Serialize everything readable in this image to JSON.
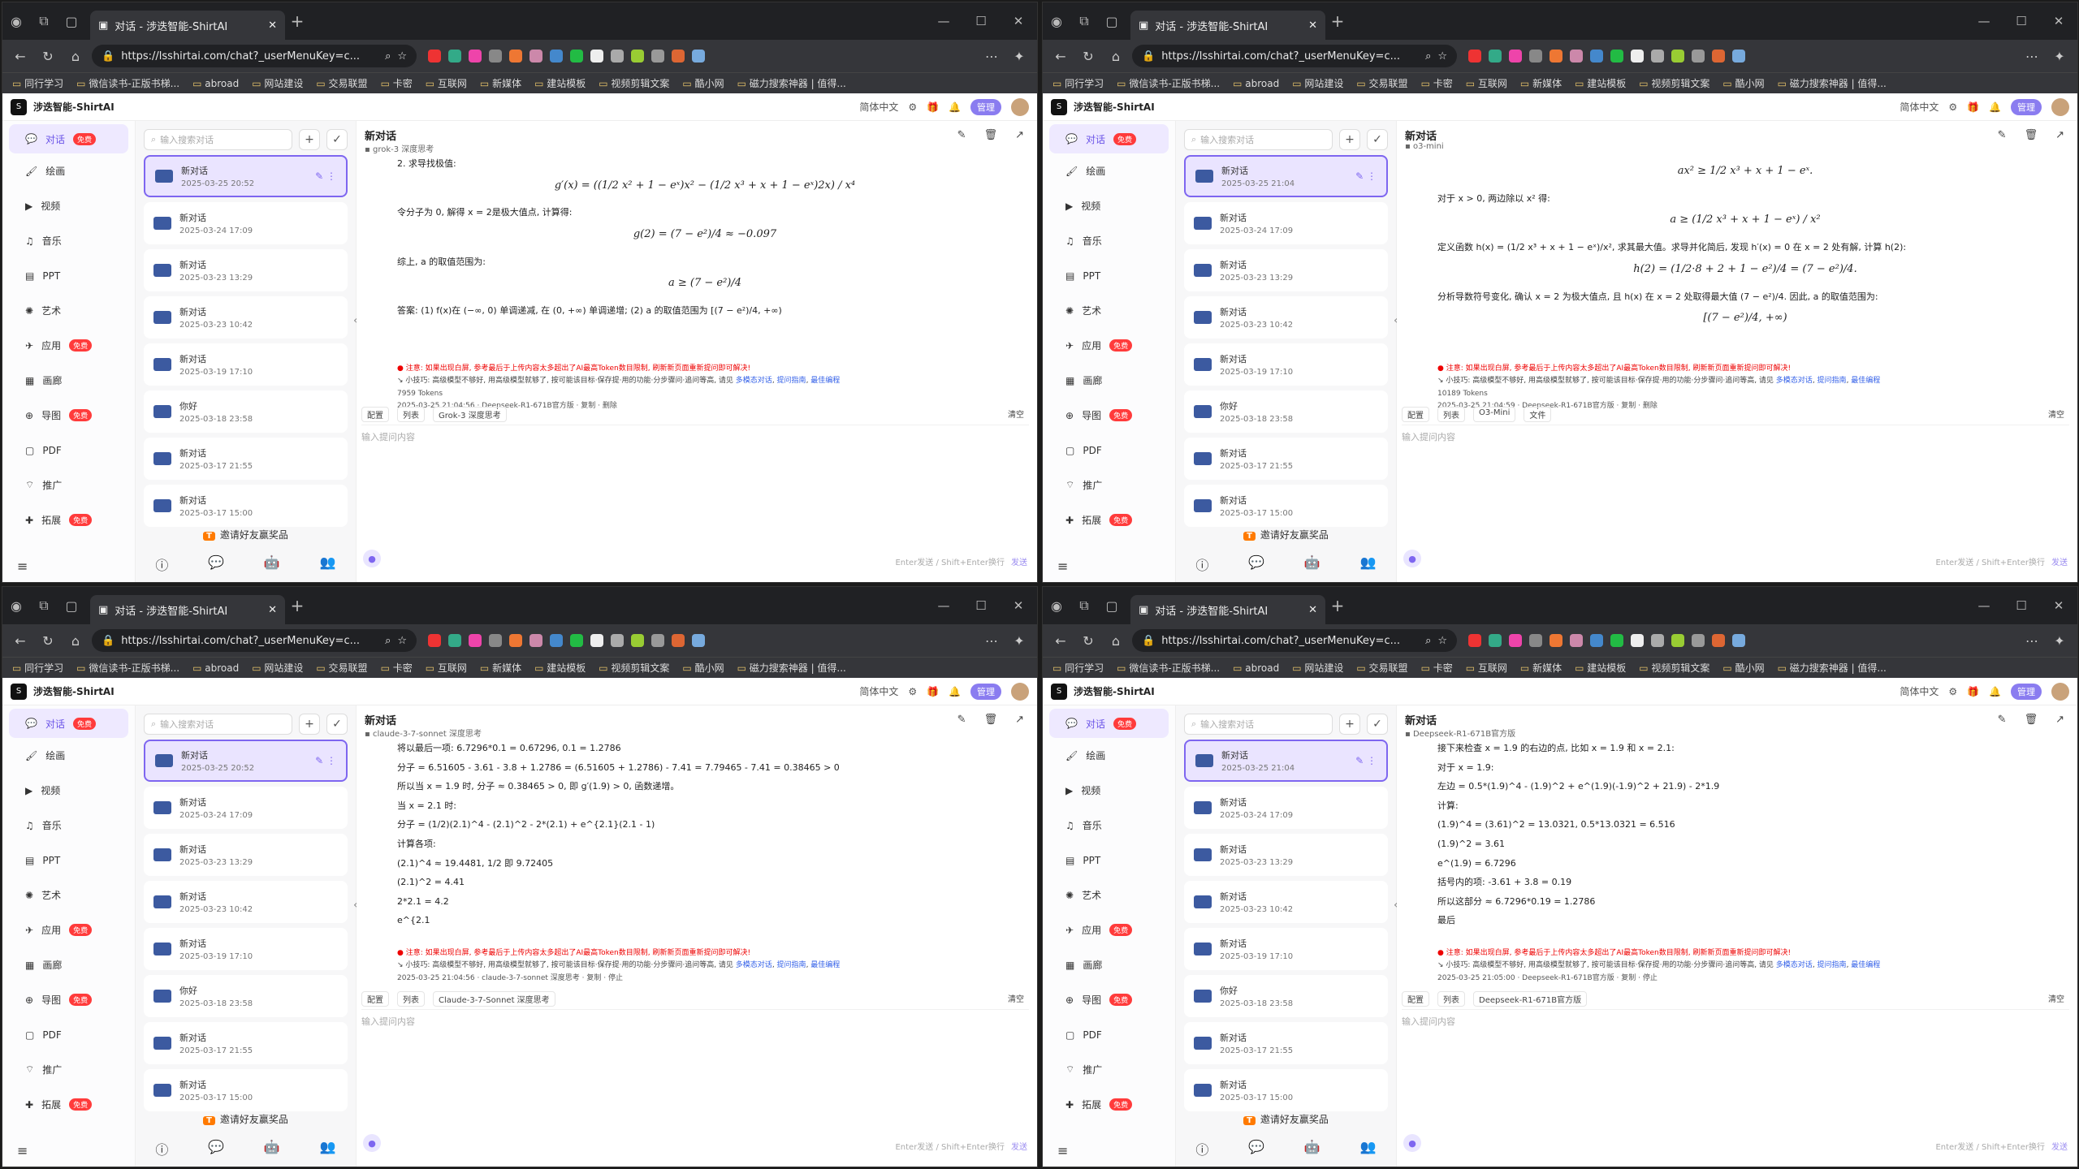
{
  "browser": {
    "tab_title": "对话 - 涉迭智能-ShirtAI",
    "url": "https://lsshirtai.com/chat?_userMenuKey=c...",
    "bookmarks": [
      "同行学习",
      "微信读书-正版书梯...",
      "abroad",
      "网站建设",
      "交易联盟",
      "卡密",
      "互联网",
      "新媒体",
      "建站模板",
      "视频剪辑文案",
      "酷小网",
      "磁力搜索神器 | 值得..."
    ]
  },
  "app": {
    "title": "涉迭智能-ShirtAI",
    "lang": "简体中文",
    "admin": "管理",
    "nav": [
      {
        "label": "对话",
        "badge": "免费"
      },
      {
        "label": "绘画",
        "badge": ""
      },
      {
        "label": "视频",
        "badge": ""
      },
      {
        "label": "音乐",
        "badge": ""
      },
      {
        "label": "PPT",
        "badge": ""
      },
      {
        "label": "艺术",
        "badge": ""
      },
      {
        "label": "应用",
        "badge": "免费"
      },
      {
        "label": "画廊",
        "badge": ""
      },
      {
        "label": "导图",
        "badge": "免费"
      },
      {
        "label": "PDF",
        "badge": ""
      },
      {
        "label": "推广",
        "badge": ""
      },
      {
        "label": "拓展",
        "badge": "免费"
      }
    ],
    "search_placeholder": "输入搜索对话",
    "invite": "邀请好友赢奖品",
    "input_placeholder": "输入提问内容",
    "send_hint": "Enter发送 / Shift+Enter换行",
    "send": "发送",
    "clear": "清空",
    "toolbar_config": "配置",
    "toolbar_list": "列表",
    "warn": "注意: 如果出现白屏, 参考最后于上传内容太多超出了AI最高Token数目限制, 刷新新页面重新提问即可解决!",
    "tip_pre": "小技巧: 高级模型不够好, 用高级模型就够了, 按可能该目标·保存提·用的功能·分步骤问·追问等高, 请见",
    "tip_links": [
      "多模态对话",
      "提问指南",
      "最佳编程"
    ]
  },
  "windows": [
    {
      "selected_date": "2025-03-25 20:52",
      "conv_list": [
        {
          "title": "新对话",
          "date": "2025-03-25 20:52"
        },
        {
          "title": "新对话",
          "date": "2025-03-24 17:09"
        },
        {
          "title": "新对话",
          "date": "2025-03-23 13:29"
        },
        {
          "title": "新对话",
          "date": "2025-03-23 10:42"
        },
        {
          "title": "新对话",
          "date": "2025-03-19 17:10"
        },
        {
          "title": "你好",
          "date": "2025-03-18 23:58"
        },
        {
          "title": "新对话",
          "date": "2025-03-17 21:55"
        },
        {
          "title": "新对话",
          "date": "2025-03-17 15:00"
        }
      ],
      "main_title": "新对话",
      "model": "grok-3 深度思考",
      "content": [
        {
          "t": "line",
          "v": "2. 求导找极值:"
        },
        {
          "t": "eq",
          "v": "g′(x) = ((1/2 x² + 1 − eˣ)x² − (1/2 x³ + x + 1 − eˣ)2x) / x⁴"
        },
        {
          "t": "line",
          "v": "令分子为 0, 解得 x = 2是极大值点, 计算得:"
        },
        {
          "t": "eq",
          "v": "g(2) = (7 − e²)/4 ≈ −0.097"
        },
        {
          "t": "line",
          "v": "综上, a 的取值范围为:"
        },
        {
          "t": "eq",
          "v": "a ≥ (7 − e²)/4"
        },
        {
          "t": "line",
          "v": "答案: (1) f(x)在 (−∞, 0) 单调递减, 在 (0, +∞) 单调递增; (2) a 的取值范围为 [(7 − e²)/4, +∞)"
        }
      ],
      "tokens": "7959 Tokens",
      "stamp": "2025-03-25 21:04:56 · Deepseek-R1-671B官方版 · 复制 · 删除",
      "model_chip": "Grok-3 深度思考",
      "extra_chip": ""
    },
    {
      "selected_date": "2025-03-25 21:04",
      "conv_list": [
        {
          "title": "新对话",
          "date": "2025-03-25 21:04"
        },
        {
          "title": "新对话",
          "date": "2025-03-24 17:09"
        },
        {
          "title": "新对话",
          "date": "2025-03-23 13:29"
        },
        {
          "title": "新对话",
          "date": "2025-03-23 10:42"
        },
        {
          "title": "新对话",
          "date": "2025-03-19 17:10"
        },
        {
          "title": "你好",
          "date": "2025-03-18 23:58"
        },
        {
          "title": "新对话",
          "date": "2025-03-17 21:55"
        },
        {
          "title": "新对话",
          "date": "2025-03-17 15:00"
        }
      ],
      "main_title": "新对话",
      "model": "o3-mini",
      "content": [
        {
          "t": "eq",
          "v": "ax² ≥ 1/2 x³ + x + 1 − eˣ."
        },
        {
          "t": "line",
          "v": "对于 x > 0, 两边除以 x² 得:"
        },
        {
          "t": "eq",
          "v": "a ≥ (1/2 x³ + x + 1 − eˣ) / x²"
        },
        {
          "t": "line",
          "v": "定义函数 h(x) = (1/2 x³ + x + 1 − eˣ)/x², 求其最大值。求导并化简后, 发现 h′(x) = 0 在 x = 2 处有解, 计算 h(2):"
        },
        {
          "t": "eq",
          "v": "h(2) = (1/2·8 + 2 + 1 − e²)/4 = (7 − e²)/4."
        },
        {
          "t": "line",
          "v": "分析导数符号变化, 确认 x = 2 为极大值点, 且 h(x) 在 x = 2 处取得最大值 (7 − e²)/4. 因此, a 的取值范围为:"
        },
        {
          "t": "eq",
          "v": "[(7 − e²)/4, +∞)"
        }
      ],
      "tokens": "10189 Tokens",
      "stamp": "2025-03-25 21:04:59 · Deepseek-R1-671B官方版 · 复制 · 删除",
      "model_chip": "O3-Mini",
      "extra_chip": "文件"
    },
    {
      "selected_date": "2025-03-25 20:52",
      "conv_list": [
        {
          "title": "新对话",
          "date": "2025-03-25 20:52"
        },
        {
          "title": "新对话",
          "date": "2025-03-24 17:09"
        },
        {
          "title": "新对话",
          "date": "2025-03-23 13:29"
        },
        {
          "title": "新对话",
          "date": "2025-03-23 10:42"
        },
        {
          "title": "新对话",
          "date": "2025-03-19 17:10"
        },
        {
          "title": "你好",
          "date": "2025-03-18 23:58"
        },
        {
          "title": "新对话",
          "date": "2025-03-17 21:55"
        },
        {
          "title": "新对话",
          "date": "2025-03-17 15:00"
        }
      ],
      "main_title": "新对话",
      "model": "claude-3-7-sonnet 深度思考",
      "content": [
        {
          "t": "line",
          "v": "将以最后一项: 6.7296*0.1 = 0.67296, 0.1 = 1.2786"
        },
        {
          "t": "line",
          "v": "分子 = 6.51605 - 3.61 - 3.8 + 1.2786 = (6.51605 + 1.2786) - 7.41 = 7.79465 - 7.41 = 0.38465 > 0"
        },
        {
          "t": "line",
          "v": "所以当 x = 1.9 时, 分子 ≈ 0.38465 > 0, 即 g′(1.9) > 0, 函数递增。"
        },
        {
          "t": "line",
          "v": "当 x = 2.1 时:"
        },
        {
          "t": "line",
          "v": "分子 = (1/2)(2.1)^4 - (2.1)^2 - 2*(2.1) + e^{2.1}(2.1 - 1)"
        },
        {
          "t": "line",
          "v": "计算各项:"
        },
        {
          "t": "line",
          "v": "(2.1)^4 ≈ 19.4481, 1/2 即 9.72405"
        },
        {
          "t": "line",
          "v": "(2.1)^2 = 4.41"
        },
        {
          "t": "line",
          "v": "2*2.1 = 4.2"
        },
        {
          "t": "line",
          "v": "e^{2.1"
        }
      ],
      "tokens": "",
      "stamp": "2025-03-25 21:04:56 · claude-3-7-sonnet 深度思考 · 复制 · 停止",
      "model_chip": "Claude-3-7-Sonnet 深度思考",
      "extra_chip": ""
    },
    {
      "selected_date": "2025-03-25 21:04",
      "conv_list": [
        {
          "title": "新对话",
          "date": "2025-03-25 21:04"
        },
        {
          "title": "新对话",
          "date": "2025-03-24 17:09"
        },
        {
          "title": "新对话",
          "date": "2025-03-23 13:29"
        },
        {
          "title": "新对话",
          "date": "2025-03-23 10:42"
        },
        {
          "title": "新对话",
          "date": "2025-03-19 17:10"
        },
        {
          "title": "你好",
          "date": "2025-03-18 23:58"
        },
        {
          "title": "新对话",
          "date": "2025-03-17 21:55"
        },
        {
          "title": "新对话",
          "date": "2025-03-17 15:00"
        }
      ],
      "main_title": "新对话",
      "model": "Deepseek-R1-671B官方版",
      "content": [
        {
          "t": "line",
          "v": "接下来检查 x = 1.9 的右边的点, 比如 x = 1.9 和 x = 2.1:"
        },
        {
          "t": "line",
          "v": "对于 x = 1.9:"
        },
        {
          "t": "line",
          "v": "左边 = 0.5*(1.9)^4 - (1.9)^2 + e^(1.9)(-1.9)^2 + 21.9) - 2*1.9"
        },
        {
          "t": "line",
          "v": "计算:"
        },
        {
          "t": "line",
          "v": "(1.9)^4 = (3.61)^2 = 13.0321, 0.5*13.0321 = 6.516"
        },
        {
          "t": "line",
          "v": "(1.9)^2 = 3.61"
        },
        {
          "t": "line",
          "v": "e^(1.9) = 6.7296"
        },
        {
          "t": "line",
          "v": "括号内的项: -3.61 + 3.8 = 0.19"
        },
        {
          "t": "line",
          "v": "所以这部分 ≈ 6.7296*0.19 = 1.2786"
        },
        {
          "t": "line",
          "v": "最后"
        }
      ],
      "tokens": "",
      "stamp": "2025-03-25 21:05:00 · Deepseek-R1-671B官方版 · 复制 · 停止",
      "model_chip": "Deepseek-R1-671B官方版",
      "extra_chip": ""
    }
  ]
}
